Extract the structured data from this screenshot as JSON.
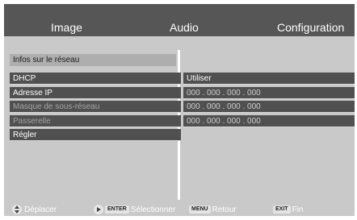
{
  "tabs": {
    "image": "Image",
    "audio": "Audio",
    "configuration": "Configuration"
  },
  "network": {
    "section_title": "Infos sur le réseau",
    "items": [
      {
        "label": "DHCP",
        "disabled": false
      },
      {
        "label": "Adresse IP",
        "disabled": false
      },
      {
        "label": "Masque de sous-réseau",
        "disabled": true
      },
      {
        "label": "Passerelle",
        "disabled": true
      },
      {
        "label": "Régler",
        "disabled": false
      }
    ],
    "values": [
      {
        "text": "Utiliser"
      },
      {
        "text": "000 . 000 . 000 . 000"
      },
      {
        "text": "000 . 000 . 000 . 000"
      },
      {
        "text": "000 . 000 . 000 . 000"
      }
    ]
  },
  "footer": {
    "move_label": "Déplacer",
    "enter_key": "ENTER",
    "select_label": "Sélectionner",
    "menu_key": "MENU",
    "back_label": "Retour",
    "exit_key": "EXIT",
    "end_label": "Fin"
  },
  "colors": {
    "header": "#565656",
    "panel": "#c9c9c9",
    "row": "#505050",
    "section": "#aeaeae"
  }
}
